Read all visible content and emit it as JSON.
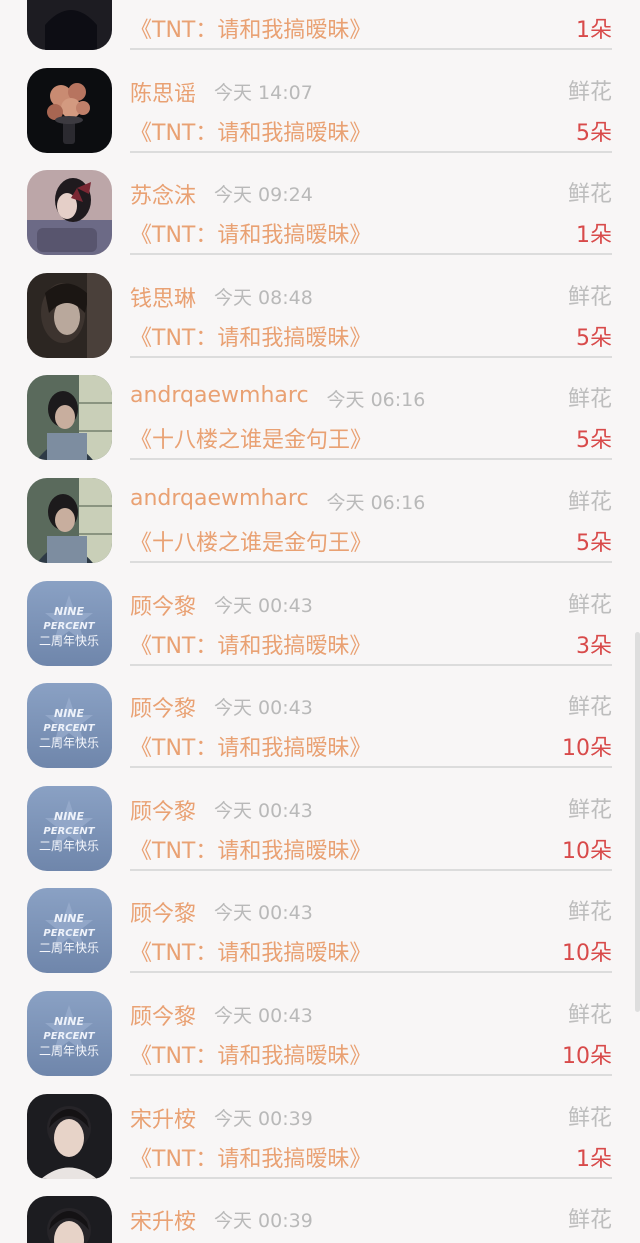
{
  "list": [
    {
      "name": "",
      "time": "",
      "gift": "",
      "song": "《TNT：请和我搞暧昧》",
      "count": "1朵",
      "avatar": "avatar-dark-portrait"
    },
    {
      "name": "陈思谣",
      "time": "今天 14:07",
      "gift": "鲜花",
      "song": "《TNT：请和我搞暧昧》",
      "count": "5朵",
      "avatar": "avatar-flowers"
    },
    {
      "name": "苏念沫",
      "time": "今天 09:24",
      "gift": "鲜花",
      "song": "《TNT：请和我搞暧昧》",
      "count": "1朵",
      "avatar": "avatar-girl-bow"
    },
    {
      "name": "钱思琳",
      "time": "今天 08:48",
      "gift": "鲜花",
      "song": "《TNT：请和我搞暧昧》",
      "count": "5朵",
      "avatar": "avatar-dim-portrait"
    },
    {
      "name": "andrqaewmharc",
      "time": "今天 06:16",
      "gift": "鲜花",
      "song": "《十八楼之谁是金句王》",
      "count": "5朵",
      "avatar": "avatar-window-boy"
    },
    {
      "name": "andrqaewmharc",
      "time": "今天 06:16",
      "gift": "鲜花",
      "song": "《十八楼之谁是金句王》",
      "count": "5朵",
      "avatar": "avatar-window-boy"
    },
    {
      "name": "顾今黎",
      "time": "今天 00:43",
      "gift": "鲜花",
      "song": "《TNT：请和我搞暧昧》",
      "count": "3朵",
      "avatar": "avatar-nine-percent"
    },
    {
      "name": "顾今黎",
      "time": "今天 00:43",
      "gift": "鲜花",
      "song": "《TNT：请和我搞暧昧》",
      "count": "10朵",
      "avatar": "avatar-nine-percent"
    },
    {
      "name": "顾今黎",
      "time": "今天 00:43",
      "gift": "鲜花",
      "song": "《TNT：请和我搞暧昧》",
      "count": "10朵",
      "avatar": "avatar-nine-percent"
    },
    {
      "name": "顾今黎",
      "time": "今天 00:43",
      "gift": "鲜花",
      "song": "《TNT：请和我搞暧昧》",
      "count": "10朵",
      "avatar": "avatar-nine-percent"
    },
    {
      "name": "顾今黎",
      "time": "今天 00:43",
      "gift": "鲜花",
      "song": "《TNT：请和我搞暧昧》",
      "count": "10朵",
      "avatar": "avatar-nine-percent"
    },
    {
      "name": "宋升桉",
      "time": "今天 00:39",
      "gift": "鲜花",
      "song": "《TNT：请和我搞暧昧》",
      "count": "1朵",
      "avatar": "avatar-boy-portrait"
    },
    {
      "name": "宋升桉",
      "time": "今天 00:39",
      "gift": "鲜花",
      "song": "",
      "count": "",
      "avatar": "avatar-boy-portrait"
    }
  ],
  "nine_percent_badge": {
    "line1": "NINE",
    "line2": "PERCENT",
    "line3": "二周年快乐"
  },
  "colors": {
    "accent": "#e9a173",
    "count": "#d84a4a",
    "muted": "#b9b9b9",
    "divider": "#dcdcdc",
    "background": "#f8f6f6"
  }
}
